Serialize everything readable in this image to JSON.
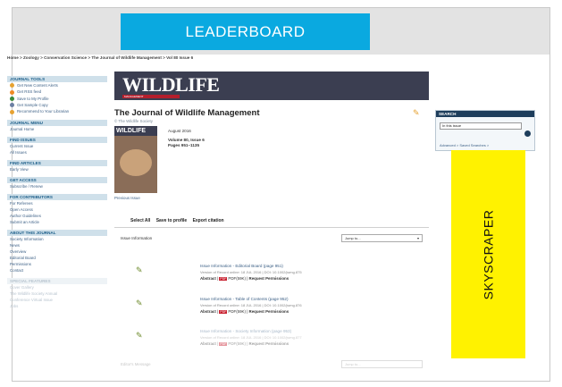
{
  "ad": {
    "leaderboard": "LEADERBOARD",
    "skyscraper": "SKYSCRAPER"
  },
  "breadcrumb": "Home > Zoology > Conservation Science > The Journal of Wildlife Management > Vol 80 Issue 6",
  "sidebar": {
    "journal_tools": {
      "heading": "JOURNAL TOOLS",
      "items": [
        "Get New Content Alerts",
        "Get RSS feed",
        "Save to My Profile",
        "Get Sample Copy",
        "Recommend to Your Librarian"
      ]
    },
    "journal_menu": {
      "heading": "JOURNAL MENU",
      "items": [
        "Journal Home"
      ]
    },
    "find_issues": {
      "heading": "FIND ISSUES",
      "items": [
        "Current Issue",
        "All Issues"
      ]
    },
    "find_articles": {
      "heading": "FIND ARTICLES",
      "items": [
        "Early View"
      ]
    },
    "get_access": {
      "heading": "GET ACCESS",
      "items": [
        "Subscribe / Renew"
      ]
    },
    "for_contributors": {
      "heading": "FOR CONTRIBUTORS",
      "items": [
        "For Referees",
        "Open Access",
        "Author Guidelines",
        "Submit an Article"
      ]
    },
    "about": {
      "heading": "ABOUT THIS JOURNAL",
      "items": [
        "Society Information",
        "News",
        "Overview",
        "Editorial Board",
        "Permissions",
        "Contact"
      ]
    },
    "special": {
      "heading": "SPECIAL FEATURES",
      "items": [
        "Cover Gallery",
        "The Wildlife Society Annual",
        "Conference Virtual Issue",
        "Jobs"
      ]
    }
  },
  "banner": {
    "title": "WILDLIFE",
    "subtitle": "MANAGEMENT"
  },
  "journal": {
    "title": "The Journal of Wildlife Management",
    "society": "© The Wildlife Society"
  },
  "cover": {
    "label": "WILDLIFE",
    "previous": "Previous Issue"
  },
  "issue": {
    "date": "August 2016",
    "volume": "Volume 80, Issue 6",
    "pages": "Pages 951–1135"
  },
  "search": {
    "heading": "SEARCH",
    "scope": "In this issue",
    "links": "Advanced > Saved Searches >"
  },
  "tabs": [
    "Select All",
    "Save to profile",
    "Export citation"
  ],
  "section": {
    "label": "Issue Information",
    "jump": "Jump to..."
  },
  "articles": [
    {
      "title": "Issue Information - Editorial Board (page 951)",
      "version": "Version of Record online: 18 JUL 2016 | DOI: 10.1002/jwmg.875",
      "abstract": "Abstract",
      "pdf": "PDF(59K)",
      "request": "Request Permissions"
    },
    {
      "title": "Issue Information - Table of Contents (page 952)",
      "version": "Version of Record online: 18 JUL 2016 | DOI: 10.1002/jwmg.876",
      "abstract": "Abstract",
      "pdf": "PDF(59K)",
      "request": "Request Permissions"
    },
    {
      "title": "Issue Information - Society Information (page 953)",
      "version": "Version of Record online: 18 JUL 2016 | DOI: 10.1002/jwmg.877",
      "abstract": "Abstract",
      "pdf": "PDF(59K)",
      "request": "Request Permissions"
    }
  ],
  "bottom": {
    "label": "Editor's Message",
    "jump": "Jump to..."
  },
  "colors": {
    "leaderboard": "#0aa9e0",
    "skyscraper": "#fff200",
    "banner": "#3b3e51",
    "accent_red": "#b41e2c"
  }
}
